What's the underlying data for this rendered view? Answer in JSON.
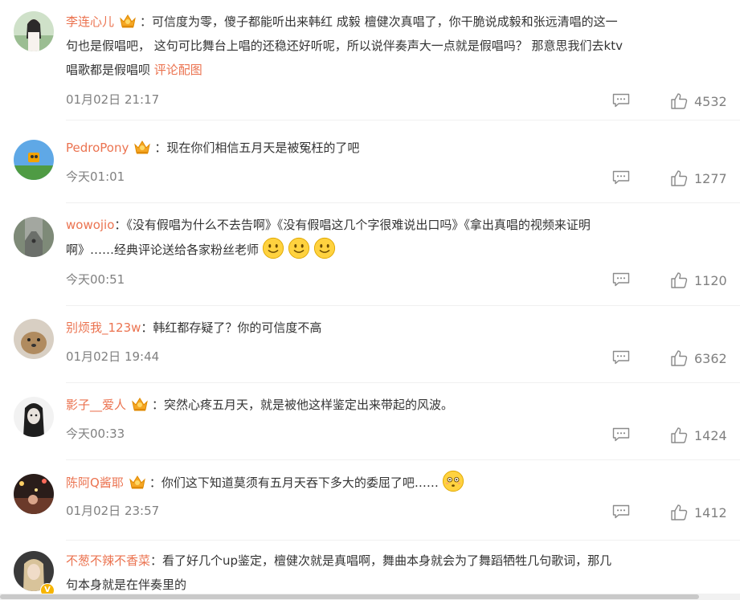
{
  "colors": {
    "username": "#eb7350",
    "meta": "#808080",
    "text": "#333333"
  },
  "icons": {
    "reply": "comment-bubble-icon",
    "like": "thumbs-up-icon",
    "vip": "crown-icon"
  },
  "comments": [
    {
      "username": "李连心儿",
      "text_lines": [
        "可信度为零，傻子都能听出来韩红 成毅 檀健次真唱了，你干脆说成毅和张远清唱的这一",
        "句也是假唱吧， 这句可比舞台上唱的还稳还好听呢，所以说伴奏声大一点就是假唱吗？ 那意思我们去ktv",
        "唱歌都是假唱呗"
      ],
      "link": "评论配图",
      "time": "01月02日 21:17",
      "likes": "4532"
    },
    {
      "username": "PedroPony",
      "text": "现在你们相信五月天是被冤枉的了吧",
      "time": "今天01:01",
      "likes": "1277"
    },
    {
      "username": "wowojio",
      "text_lines": [
        "《没有假唱为什么不去告啊》《没有假唱这几个字很难说出口吗》《拿出真唱的视频来证明",
        "啊》……经典评论送给各家粉丝老师"
      ],
      "time": "今天00:51",
      "likes": "1120"
    },
    {
      "username": "别烦我_123w",
      "text": "韩红都存疑了？你的可信度不高",
      "time": "01月02日 19:44",
      "likes": "6362"
    },
    {
      "username": "影子__爱人",
      "text": "突然心疼五月天，就是被他这样鉴定出来带起的风波。",
      "time": "今天00:33",
      "likes": "1424"
    },
    {
      "username": "陈阿Q酱耶",
      "text": "你们这下知道莫须有五月天吞下多大的委屈了吧……",
      "time": "01月02日 23:57",
      "likes": "1412"
    },
    {
      "username": "不葱不辣不香菜",
      "text_lines": [
        "看了好几个up鉴定，檀健次就是真唱啊，舞曲本身就会为了舞蹈牺牲几句歌词，那几",
        "句本身就是在伴奏里的"
      ]
    }
  ],
  "colon": "："
}
